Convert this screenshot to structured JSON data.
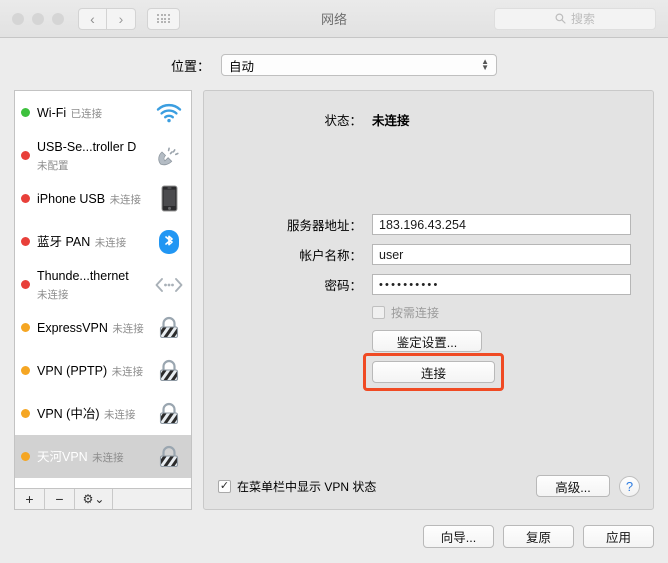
{
  "window": {
    "title": "网络",
    "traffic_lights": [
      "close",
      "minimize",
      "zoom"
    ],
    "nav_back": "‹",
    "nav_forward": "›",
    "search_placeholder": "搜索"
  },
  "location": {
    "label": "位置：",
    "value": "自动"
  },
  "sidebar": {
    "items": [
      {
        "name": "Wi-Fi",
        "status": "已连接",
        "dot": "#3ec13e",
        "icon": "wifi-icon"
      },
      {
        "name": "USB-Se...troller D",
        "status": "未配置",
        "dot": "#e8403a",
        "icon": "modem-icon"
      },
      {
        "name": "iPhone USB",
        "status": "未连接",
        "dot": "#e8403a",
        "icon": "iphone-icon"
      },
      {
        "name": "蓝牙 PAN",
        "status": "未连接",
        "dot": "#e8403a",
        "icon": "bluetooth-icon"
      },
      {
        "name": "Thunde...thernet",
        "status": "未连接",
        "dot": "#e8403a",
        "icon": "thunderbolt-icon"
      },
      {
        "name": "ExpressVPN",
        "status": "未连接",
        "dot": "#f5a623",
        "icon": "vpn-lock-icon"
      },
      {
        "name": "VPN (PPTP)",
        "status": "未连接",
        "dot": "#f5a623",
        "icon": "vpn-lock-icon"
      },
      {
        "name": "VPN (中冶)",
        "status": "未连接",
        "dot": "#f5a623",
        "icon": "vpn-lock-icon"
      },
      {
        "name": "天河VPN",
        "status": "未连接",
        "dot": "#f5a623",
        "icon": "vpn-lock-icon",
        "selected": true
      }
    ],
    "toolbar": {
      "add": "+",
      "remove": "−",
      "gear": "⚙",
      "gear_chevron": "⌄"
    }
  },
  "panel": {
    "status_label": "状态：",
    "status_value": "未连接",
    "fields": [
      {
        "label": "服务器地址：",
        "value": "183.196.43.254"
      },
      {
        "label": "帐户名称：",
        "value": "user"
      },
      {
        "label": "密码：",
        "value": "••••••••••"
      }
    ],
    "on_demand_label": "按需连接",
    "auth_button": "鉴定设置...",
    "connect_button": "连接",
    "show_vpn_status_label": "在菜单栏中显示 VPN 状态",
    "advanced_button": "高级...",
    "help_button": "?",
    "highlight_color": "#f04a23"
  },
  "footer": {
    "assistant": "向导...",
    "revert": "复原",
    "apply": "应用"
  }
}
